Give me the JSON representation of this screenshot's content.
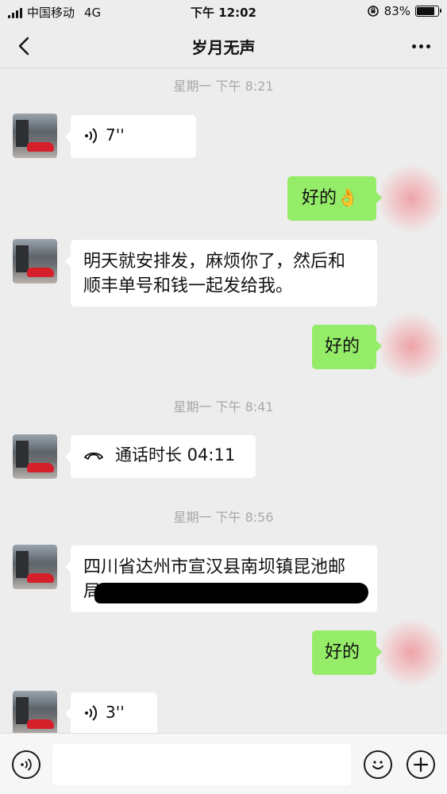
{
  "status_bar": {
    "carrier": "中国移动",
    "network": "4G",
    "time": "下午 12:02",
    "battery": "83%",
    "battery_level": 0.83
  },
  "nav": {
    "title": "岁月无声",
    "back_icon": "chevron-left-icon",
    "more_icon": "more-dots-icon"
  },
  "messages": {
    "t1": "星期一 下午 8:21",
    "voice1": "7''",
    "ok_emoji": "好的👌",
    "text1_line1": "明天就安排发，麻烦你了，然后和",
    "text1_line2": "顺丰单号和钱一起发给我。",
    "ok2": "好的",
    "t2": "星期一 下午 8:41",
    "call": "通话时长 04:11",
    "t3": "星期一 下午 8:56",
    "addr_line1": "四川省达州市宣汉县南坝镇昆池邮",
    "addr_line2_visible": "局",
    "ok3": "好的",
    "voice2": "3''"
  },
  "input_bar": {
    "voice_icon": "voice-toggle-icon",
    "emoji_icon": "emoji-icon",
    "plus_icon": "plus-icon",
    "input_value": ""
  },
  "colors": {
    "background": "#ededed",
    "bubble_in": "#ffffff",
    "bubble_out": "#95ec69",
    "timestamp": "#a8a8a8"
  }
}
